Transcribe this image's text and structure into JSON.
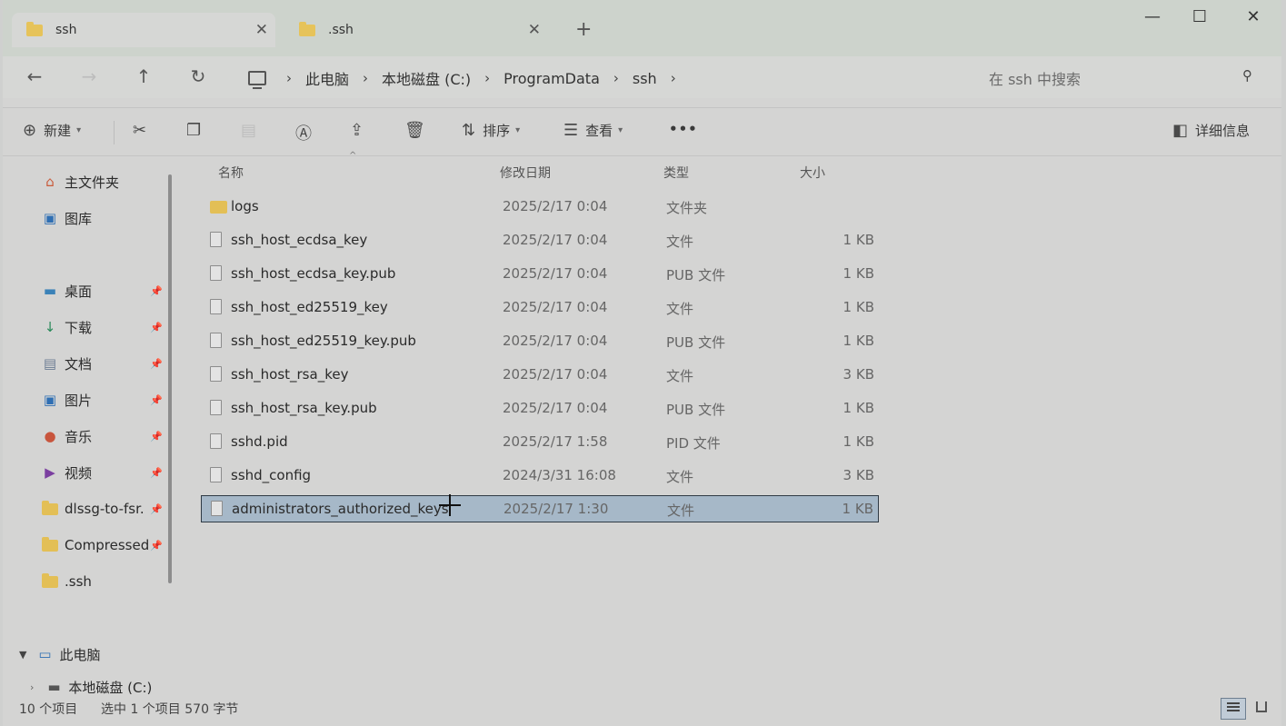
{
  "tabs": [
    {
      "label": "ssh"
    },
    {
      "label": ".ssh"
    }
  ],
  "window_controls": {
    "minimize": "—",
    "maximize": "☐",
    "close": "✕"
  },
  "breadcrumb": [
    "此电脑",
    "本地磁盘 (C:)",
    "ProgramData",
    "ssh"
  ],
  "search": {
    "placeholder": "在 ssh 中搜索"
  },
  "toolbar": {
    "new_label": "新建",
    "sort_label": "排序",
    "view_label": "查看",
    "more_label": "•••",
    "details_label": "详细信息"
  },
  "sidebar": {
    "home": "主文件夹",
    "gallery": "图库",
    "desktop": "桌面",
    "downloads": "下载",
    "documents": "文档",
    "pictures": "图片",
    "music": "音乐",
    "videos": "视频",
    "pinned1": "dlssg-to-fsr.",
    "pinned2": "Compressed",
    "pinned3": ".ssh",
    "this_pc": "此电脑",
    "local_disk": "本地磁盘 (C:)"
  },
  "columns": {
    "name": "名称",
    "date": "修改日期",
    "type": "类型",
    "size": "大小"
  },
  "files": [
    {
      "name": "logs",
      "date": "2025/2/17 0:04",
      "type": "文件夹",
      "size": ""
    },
    {
      "name": "ssh_host_ecdsa_key",
      "date": "2025/2/17 0:04",
      "type": "文件",
      "size": "1 KB"
    },
    {
      "name": "ssh_host_ecdsa_key.pub",
      "date": "2025/2/17 0:04",
      "type": "PUB 文件",
      "size": "1 KB"
    },
    {
      "name": "ssh_host_ed25519_key",
      "date": "2025/2/17 0:04",
      "type": "文件",
      "size": "1 KB"
    },
    {
      "name": "ssh_host_ed25519_key.pub",
      "date": "2025/2/17 0:04",
      "type": "PUB 文件",
      "size": "1 KB"
    },
    {
      "name": "ssh_host_rsa_key",
      "date": "2025/2/17 0:04",
      "type": "文件",
      "size": "3 KB"
    },
    {
      "name": "ssh_host_rsa_key.pub",
      "date": "2025/2/17 0:04",
      "type": "PUB 文件",
      "size": "1 KB"
    },
    {
      "name": "sshd.pid",
      "date": "2025/2/17 1:58",
      "type": "PID 文件",
      "size": "1 KB"
    },
    {
      "name": "sshd_config",
      "date": "2024/3/31 16:08",
      "type": "文件",
      "size": "3 KB"
    },
    {
      "name": "administrators_authorized_keys",
      "date": "2025/2/17 1:30",
      "type": "文件",
      "size": "1 KB"
    }
  ],
  "status": {
    "count": "10 个项目",
    "selected": "选中 1 个项目  570 字节"
  }
}
